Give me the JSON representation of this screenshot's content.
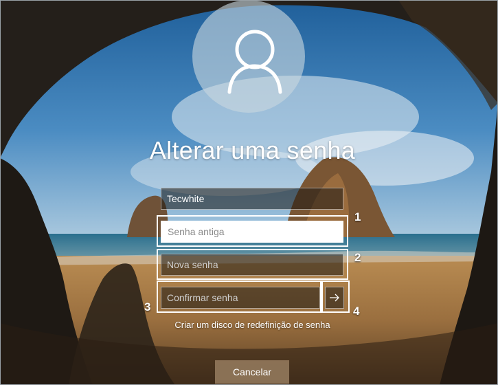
{
  "title": "Alterar uma senha",
  "fields": {
    "username_value": "Tecwhite",
    "old_password_placeholder": "Senha antiga",
    "new_password_placeholder": "Nova senha",
    "confirm_password_placeholder": "Confirmar senha"
  },
  "callouts": [
    "1",
    "2",
    "3",
    "4"
  ],
  "reset_disk_link": "Criar um disco de redefinição de senha",
  "cancel_label": "Cancelar",
  "icons": {
    "avatar": "user-silhouette-icon",
    "submit": "arrow-right-icon"
  },
  "colors": {
    "field_background": "#1c1812",
    "active_field": "#ffffff",
    "cancel_button": "#967d5f"
  }
}
